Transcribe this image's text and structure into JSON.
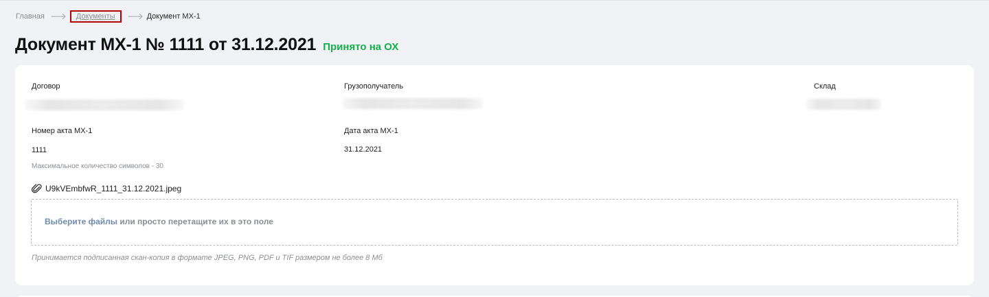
{
  "breadcrumb": {
    "home": "Главная",
    "documents": "Документы",
    "current": "Документ МХ-1"
  },
  "header": {
    "title": "Документ МХ-1 № 1111 от 31.12.2021",
    "status": "Принято на ОХ",
    "status_color": "#13b04a"
  },
  "form": {
    "contract_label": "Договор",
    "consignee_label": "Грузополучатель",
    "warehouse_label": "Склад",
    "act_number_label": "Номер акта МХ-1",
    "act_number_value": "1111",
    "act_number_hint": "Максимальное количество символов - 30",
    "act_date_label": "Дата акта МХ-1",
    "act_date_value": "31.12.2021"
  },
  "attachment": {
    "icon": "paperclip-icon",
    "filename": "U9kVEmbfwR_1111_31.12.2021.jpeg"
  },
  "upload": {
    "link_text": "Выберите файлы",
    "rest_text": " или просто перетащите их в это поле",
    "hint": "Принимается подписанная скан-копия в формате JPEG, PNG, PDF и TIF размером не более 8 Мб"
  }
}
